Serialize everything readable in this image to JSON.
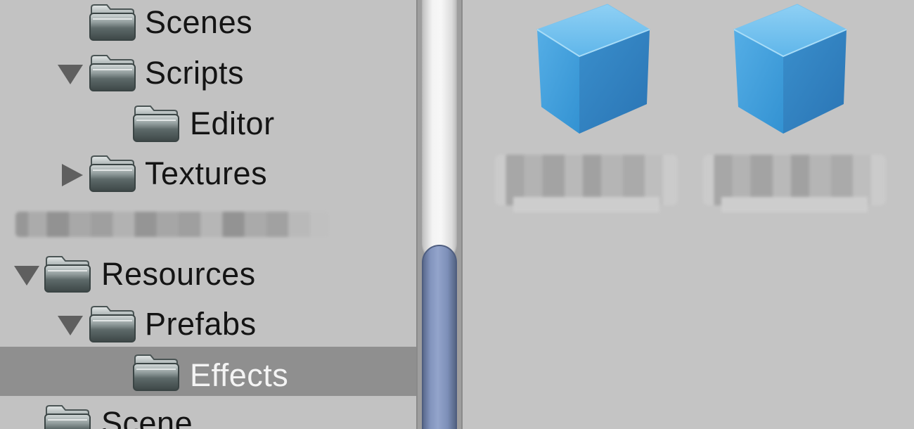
{
  "project_tree": {
    "items": [
      {
        "label": "Scenes",
        "arrow": "none",
        "depth": 2,
        "selected": false
      },
      {
        "label": "Scripts",
        "arrow": "expanded",
        "depth": 2,
        "selected": false
      },
      {
        "label": "Editor",
        "arrow": "none",
        "depth": 3,
        "selected": false
      },
      {
        "label": "Textures",
        "arrow": "collapsed",
        "depth": 2,
        "selected": false
      },
      {
        "label": "",
        "arrow": "none",
        "depth": 1,
        "selected": false,
        "obscured": true
      },
      {
        "label": "Resources",
        "arrow": "expanded",
        "depth": 1,
        "selected": false
      },
      {
        "label": "Prefabs",
        "arrow": "expanded",
        "depth": 2,
        "selected": false
      },
      {
        "label": "Effects",
        "arrow": "none",
        "depth": 3,
        "selected": true
      },
      {
        "label": "Scene",
        "arrow": "none",
        "depth": 1,
        "selected": false
      }
    ]
  },
  "asset_grid": {
    "items": [
      {
        "icon": "prefab-cube-icon",
        "name": ""
      },
      {
        "icon": "prefab-cube-icon",
        "name": ""
      }
    ]
  },
  "colors": {
    "panel_bg": "#c2c2c2",
    "selection_bg": "#8f8f8f",
    "scroll_thumb": "#8294bd",
    "cube_blue": "#4aa3dc"
  }
}
